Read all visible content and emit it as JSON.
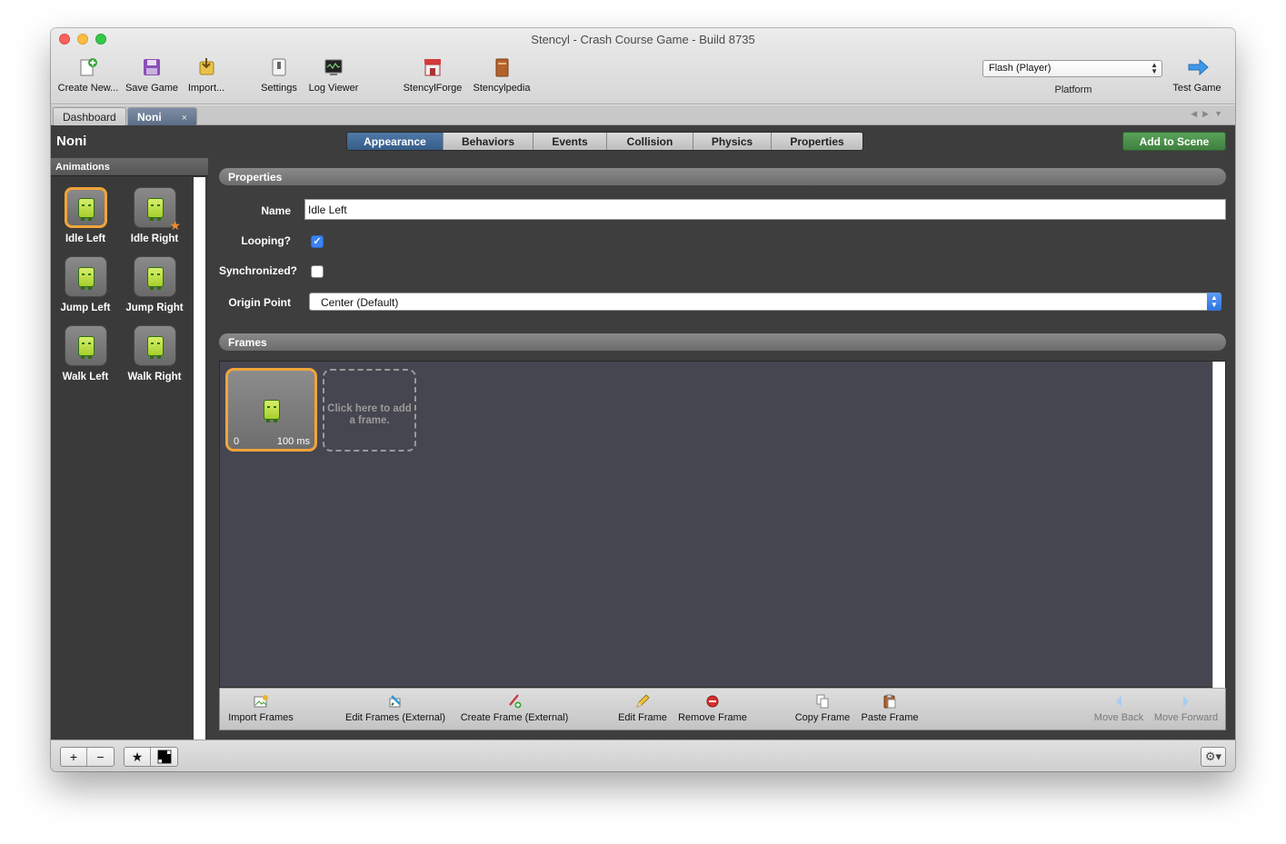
{
  "window": {
    "title": "Stencyl - Crash Course Game - Build 8735"
  },
  "toolbar": {
    "create_new": "Create New...",
    "save_game": "Save Game",
    "import": "Import...",
    "settings": "Settings",
    "log_viewer": "Log Viewer",
    "stencylforge": "StencylForge",
    "stencylpedia": "Stencylpedia",
    "platform_value": "Flash (Player)",
    "platform_label": "Platform",
    "test_game": "Test Game"
  },
  "tabs": [
    {
      "label": "Dashboard"
    },
    {
      "label": "Noni",
      "close": "×"
    }
  ],
  "header": {
    "actor_name": "Noni",
    "segments": [
      "Appearance",
      "Behaviors",
      "Events",
      "Collision",
      "Physics",
      "Properties"
    ],
    "active_segment": "Appearance",
    "add_to_scene": "Add to Scene"
  },
  "sidebar": {
    "title": "Animations",
    "items": [
      {
        "label": "Idle Left",
        "selected": true
      },
      {
        "label": "Idle Right",
        "default": true
      },
      {
        "label": "Jump Left"
      },
      {
        "label": "Jump Right"
      },
      {
        "label": "Walk Left"
      },
      {
        "label": "Walk Right"
      }
    ]
  },
  "properties": {
    "section_title": "Properties",
    "name_label": "Name",
    "name_value": "Idle Left",
    "looping_label": "Looping?",
    "looping_checked": true,
    "synchronized_label": "Synchronized?",
    "synchronized_checked": false,
    "origin_label": "Origin Point",
    "origin_value": "Center (Default)"
  },
  "frames": {
    "section_title": "Frames",
    "items": [
      {
        "index": "0",
        "duration": "100 ms"
      }
    ],
    "add_hint": "Click here to add a frame."
  },
  "frames_toolbar": {
    "import_frames": "Import Frames",
    "edit_frames_external": "Edit Frames (External)",
    "create_frame_external": "Create Frame (External)",
    "edit_frame": "Edit Frame",
    "remove_frame": "Remove Frame",
    "copy_frame": "Copy Frame",
    "paste_frame": "Paste Frame",
    "move_back": "Move Back",
    "move_forward": "Move Forward"
  },
  "bottom": {
    "add": "+",
    "remove": "−",
    "star": "★",
    "gear": "⚙▾"
  },
  "colors": {
    "accent_selected": "#f0a43a",
    "segment_active": "#375d88",
    "add_scene_green": "#3f7f3f"
  }
}
